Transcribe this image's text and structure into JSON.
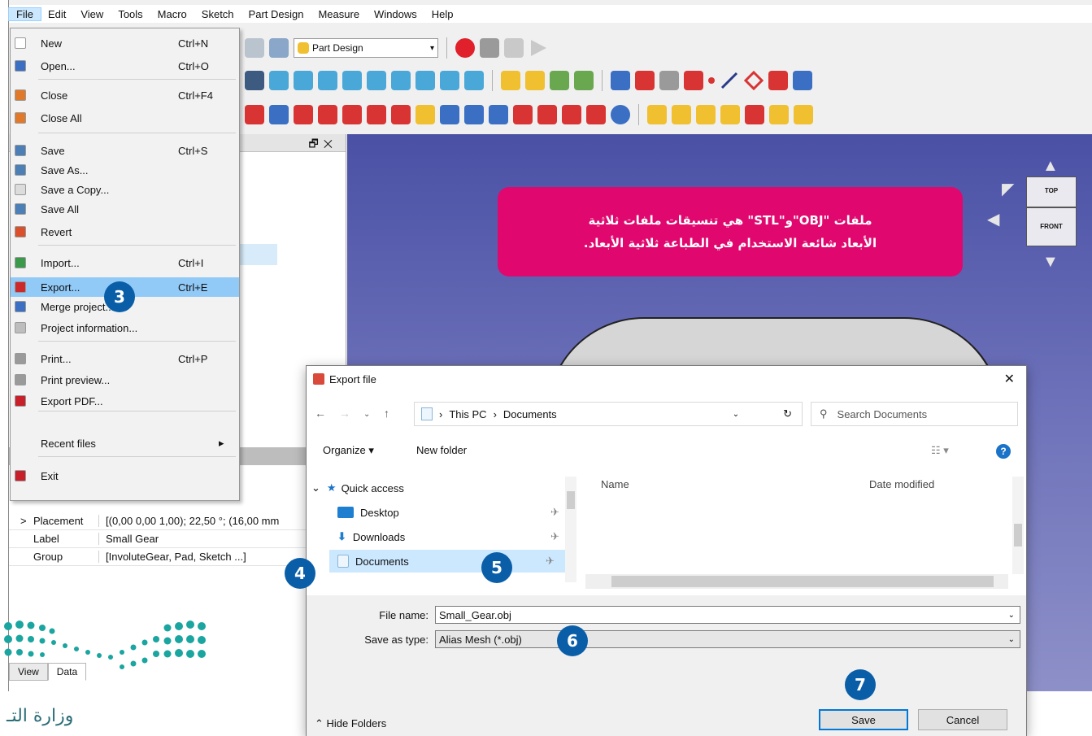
{
  "menubar": {
    "items": [
      "File",
      "Edit",
      "View",
      "Tools",
      "Macro",
      "Sketch",
      "Part Design",
      "Measure",
      "Windows",
      "Help"
    ]
  },
  "toolbar": {
    "workbench": "Part Design",
    "colors": {
      "record": "#e0202a",
      "stop": "#9a9a9a",
      "play": "#c9c9c9",
      "view_icon": "#4aa8d8",
      "part_icon": "#d93434",
      "yellow_icon": "#f0c030"
    }
  },
  "file_menu": {
    "items": [
      {
        "label": "New",
        "shortcut": "Ctrl+N",
        "icon": "new-document-icon",
        "color": "#ffffff"
      },
      {
        "label": "Open...",
        "shortcut": "Ctrl+O",
        "icon": "open-folder-icon",
        "color": "#3a6fc4"
      },
      {
        "label": "Close",
        "shortcut": "Ctrl+F4",
        "icon": "close-icon",
        "color": "#e07a2a"
      },
      {
        "label": "Close All",
        "shortcut": "",
        "icon": "close-all-icon",
        "color": "#e07a2a"
      },
      {
        "label": "Save",
        "shortcut": "Ctrl+S",
        "icon": "save-icon",
        "color": "#4b7fb5"
      },
      {
        "label": "Save As...",
        "shortcut": "",
        "icon": "save-as-icon",
        "color": "#4b7fb5"
      },
      {
        "label": "Save a Copy...",
        "shortcut": "",
        "icon": "save-copy-icon",
        "color": "#dcdcdc"
      },
      {
        "label": "Save All",
        "shortcut": "",
        "icon": "save-all-icon",
        "color": "#4b7fb5"
      },
      {
        "label": "Revert",
        "shortcut": "",
        "icon": "revert-icon",
        "color": "#d9502a"
      },
      {
        "label": "Import...",
        "shortcut": "Ctrl+I",
        "icon": "import-icon",
        "color": "#3a9a4a"
      },
      {
        "label": "Export...",
        "shortcut": "Ctrl+E",
        "icon": "export-icon",
        "color": "#cc2a2a"
      },
      {
        "label": "Merge project...",
        "shortcut": "",
        "icon": "merge-icon",
        "color": "#3a6fc4"
      },
      {
        "label": "Project information...",
        "shortcut": "",
        "icon": "info-icon",
        "color": "#bdbdbd"
      },
      {
        "label": "Print...",
        "shortcut": "Ctrl+P",
        "icon": "print-icon",
        "color": "#9a9a9a"
      },
      {
        "label": "Print preview...",
        "shortcut": "",
        "icon": "print-preview-icon",
        "color": "#9a9a9a"
      },
      {
        "label": "Export PDF...",
        "shortcut": "",
        "icon": "pdf-icon",
        "color": "#c8202a"
      },
      {
        "label": "Recent files",
        "shortcut": "",
        "icon": "",
        "color": ""
      },
      {
        "label": "Exit",
        "shortcut": "",
        "icon": "exit-icon",
        "color": "#c8202a"
      }
    ]
  },
  "combo_view": {
    "tabs": [
      "View",
      "Data"
    ]
  },
  "properties": [
    {
      "key": "Placement",
      "value": "[(0,00 0,00 1,00); 22,50 °; (16,00 mm"
    },
    {
      "key": "Label",
      "value": "Small Gear"
    },
    {
      "key": "Group",
      "value": "[InvoluteGear, Pad, Sketch ...]"
    }
  ],
  "navcube": {
    "top": "TOP",
    "front": "FRONT"
  },
  "note": {
    "line1": "ملفات \"OBJ\"و\"STL\" هي تنسيقات ملفات ثلاثية",
    "line2": "الأبعاد شائعة الاستخدام في الطباعة ثلاثية الأبعاد."
  },
  "export_dialog": {
    "title": "Export file",
    "path": [
      "This PC",
      "Documents"
    ],
    "search_placeholder": "Search Documents",
    "organize": "Organize ▾",
    "new_folder": "New folder",
    "nav": [
      {
        "label": "Quick access",
        "icon": "star-icon"
      },
      {
        "label": "Desktop",
        "icon": "desktop-icon"
      },
      {
        "label": "Downloads",
        "icon": "downloads-icon"
      },
      {
        "label": "Documents",
        "icon": "documents-icon"
      }
    ],
    "columns": [
      "Name",
      "Date modified"
    ],
    "file_name_label": "File name:",
    "file_name": "Small_Gear.obj",
    "save_as_type_label": "Save as type:",
    "save_as_type": "Alias Mesh (*.obj)",
    "save": "Save",
    "cancel": "Cancel",
    "hide_folders": "Hide Folders"
  },
  "callouts": [
    "3",
    "4",
    "5",
    "6",
    "7"
  ],
  "ministry": {
    "text": "وزارة التـ"
  }
}
